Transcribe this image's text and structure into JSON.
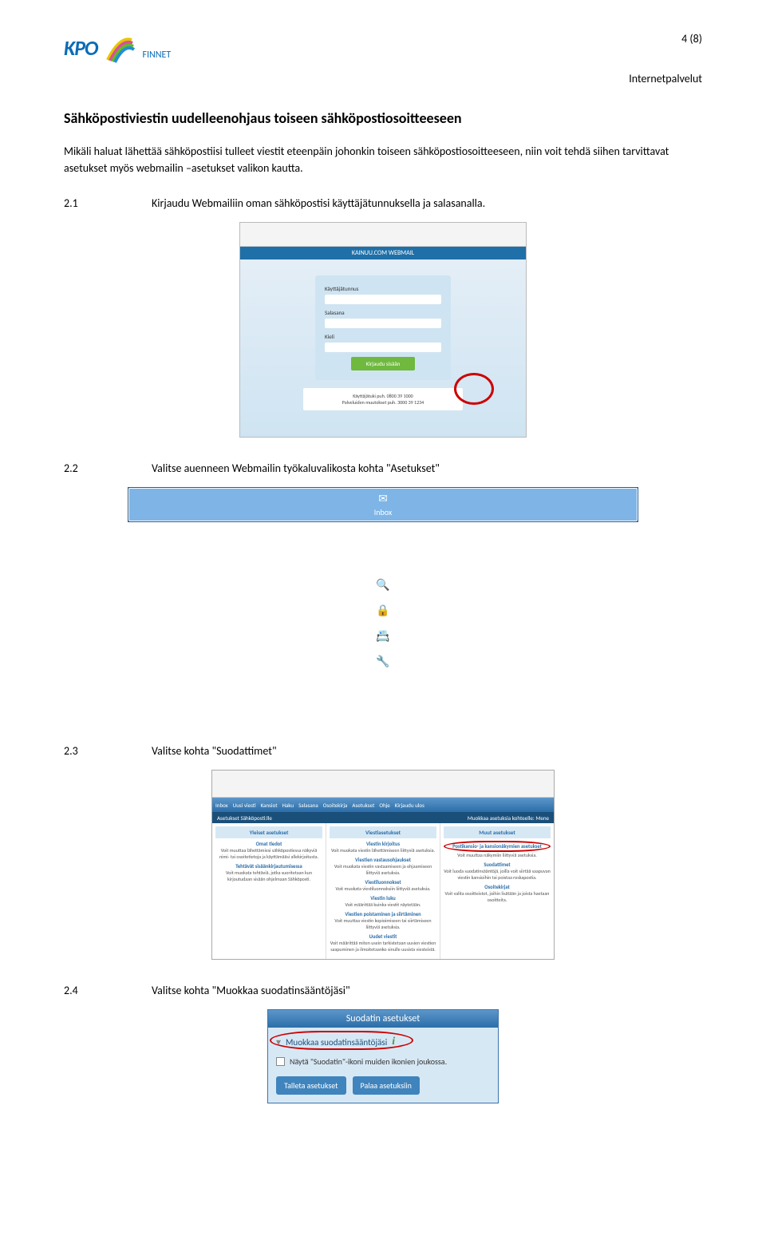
{
  "header": {
    "logo_text": "KPO",
    "logo_sub": "FINNET",
    "page_number": "4 (8)",
    "subheader": "Internetpalvelut"
  },
  "section": {
    "heading": "Sähköpostiviestin uudelleenohjaus toiseen sähköpostiosoitteeseen",
    "intro": "Mikäli haluat lähettää sähköpostiisi tulleet viestit eteenpäin johonkin toiseen sähköpostiosoitteeseen, niin voit tehdä siihen tarvittavat asetukset myös webmailin –asetukset valikon kautta."
  },
  "steps": {
    "s21_num": "2.1",
    "s21_text": "Kirjaudu Webmailiin oman sähköpostisi käyttäjätunnuksella ja salasanalla.",
    "s22_num": "2.2",
    "s22_text": "Valitse auenneen Webmailin työkaluvalikosta kohta \"Asetukset\"",
    "s23_num": "2.3",
    "s23_text": "Valitse kohta \"Suodattimet\"",
    "s24_num": "2.4",
    "s24_text": "Valitse kohta \"Muokkaa suodatinsääntöjäsi\""
  },
  "login": {
    "banner": "KAINUU.COM WEBMAIL",
    "label_user": "Käyttäjätunnus",
    "label_pass": "Salasana",
    "label_lang": "Kieli",
    "button": "Kirjaudu sisään",
    "info1": "Käyttäjätuki puh. 0800 39 1000",
    "info2": "Palveluiden muutokset puh. 3000 39 1234"
  },
  "toolbar": {
    "items": [
      {
        "label": "Inbox",
        "icon": "✉"
      },
      {
        "label": "Uusi viesti",
        "icon": "✎"
      },
      {
        "label": "Kansiot",
        "icon": "🗀"
      },
      {
        "label": "Haku",
        "icon": "🔍"
      },
      {
        "label": "Salasana",
        "icon": "🔒"
      },
      {
        "label": "Osoitekirja",
        "icon": "📇"
      },
      {
        "label": "Asetukset",
        "icon": "🔧"
      },
      {
        "label": "Ohje",
        "icon": "✔"
      },
      {
        "label": "Kirjaudu ulos",
        "icon": "✖"
      }
    ]
  },
  "settings": {
    "title_left": "Asetukset Sähköposti:lle",
    "title_right_a": "Muokkaa asetuksia kohteelle:",
    "title_right_b": "Mene",
    "col1": {
      "hdr": "Yleiset asetukset",
      "s1_t": "Omat tiedot",
      "s1_b": "Voit muuttaa lähettämiesi sähköpostiessa näkyviä nimi- tai osoitetietoja ja käyttämääsi allekirjoitusta.",
      "s2_t": "Tehtävät sisäänkirjautumisessa",
      "s2_b": "Voit muokata tehtäviä, jotka suoritetaan kun kirjoutudaan sisään ohjelmaan Sähköposti."
    },
    "col2": {
      "hdr": "Viestiasetukset",
      "s1_t": "Viestin kirjoitus",
      "s1_b": "Voit muokata viestin lähettämiseen liittyviä asetuksia.",
      "s2_t": "Viestien vastausohjaukset",
      "s2_b": "Voit muokata viestin vastaamiseen ja ohjaamiseen liittyviä asetuksia.",
      "s3_t": "Viestiluonnokset",
      "s3_b": "Voit muokata viestiluonnoksiin liittyviä asetuksia.",
      "s4_t": "Viestin luku",
      "s4_b": "Voit määrittää kuinka viestit näytetään.",
      "s5_t": "Viestien poistaminen ja siirtäminen",
      "s5_b": "Voit muuttaa viestin kopioimiseen tai siirtämiseen liittyviä asetuksia.",
      "s6_t": "Uudet viestit",
      "s6_b": "Voit määrittää miten usein tarkistetaan uusien viestien saapuminen ja ilmoitetaanko sinulle uusista viesteistä."
    },
    "col3": {
      "hdr": "Muut asetukset",
      "s1_t": "Postikansio- ja kansionäkymien asetukset",
      "s1_b": "Voit muuttaa näkymiin liittyviä asetuksia.",
      "s2_t": "Suodattimet",
      "s2_b": "Voit luoda suodatinsääntöjä, joilla voit siirtää saapuvan viestin kansioihin tai poistaa roskapostia.",
      "s3_t": "Osoitekirjat",
      "s3_b": "Voit valita osoitteistot, joihin lisätään ja joista haetaan osoitteita."
    }
  },
  "filter": {
    "header": "Suodatin asetukset",
    "row1": "Muokkaa suodatinsääntöjäsi",
    "row2": "Näytä \"Suodatin\"-ikoni muiden ikonien joukossa.",
    "btn1": "Talleta asetukset",
    "btn2": "Palaa asetuksiin"
  }
}
